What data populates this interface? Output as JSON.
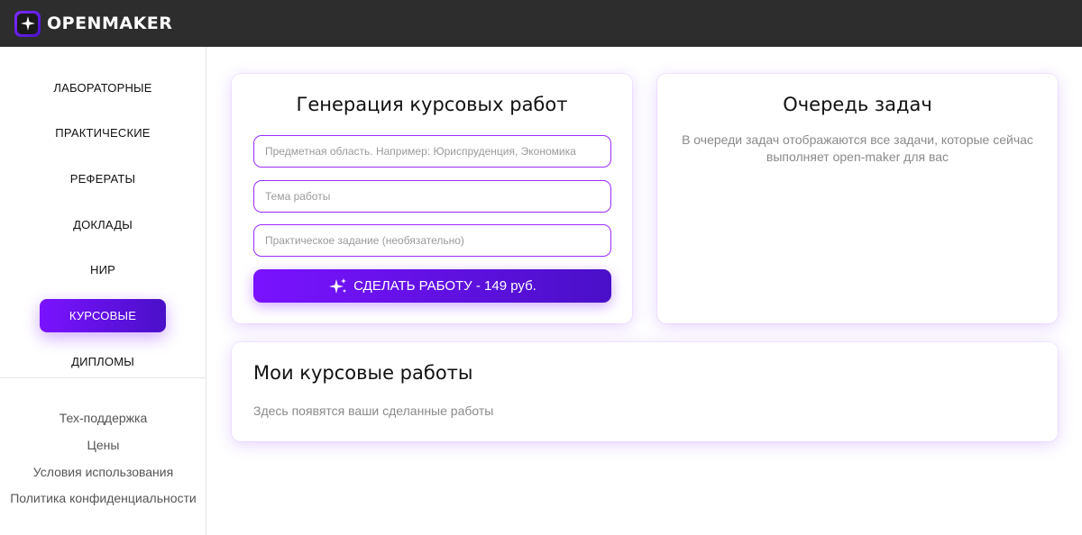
{
  "brand": {
    "name": "OPENMAKER"
  },
  "sidebar": {
    "items": [
      {
        "label": "ЛАБОРАТОРНЫЕ"
      },
      {
        "label": "ПРАКТИЧЕСКИЕ"
      },
      {
        "label": "РЕФЕРАТЫ"
      },
      {
        "label": "ДОКЛАДЫ"
      },
      {
        "label": "НИР"
      },
      {
        "label": "КУРСОВЫЕ",
        "active": true
      },
      {
        "label": "ДИПЛОМЫ"
      }
    ],
    "links": [
      {
        "label": "Тех-поддержка"
      },
      {
        "label": "Цены"
      },
      {
        "label": "Условия использования"
      },
      {
        "label": "Политика конфиденциальности"
      }
    ]
  },
  "generator": {
    "title": "Генерация курсовых работ",
    "fields": [
      {
        "placeholder": "Предметная область. Например: Юриспруденция, Экономика",
        "value": ""
      },
      {
        "placeholder": "Тема работы",
        "value": ""
      },
      {
        "placeholder": "Практическое задание (необязательно)",
        "value": ""
      }
    ],
    "submit_label": "СДЕЛАТЬ РАБОТУ - 149 руб."
  },
  "queue": {
    "title": "Очередь задач",
    "description": "В очереди задач отображаются все задачи, которые сейчас выполняет open-maker для вас"
  },
  "my_works": {
    "title": "Мои курсовые работы",
    "empty_text": "Здесь появятся ваши сделанные работы"
  },
  "colors": {
    "header_bg": "#2d2d2d",
    "accent": "#7a12ff",
    "accent_dark": "#4a10c8"
  }
}
